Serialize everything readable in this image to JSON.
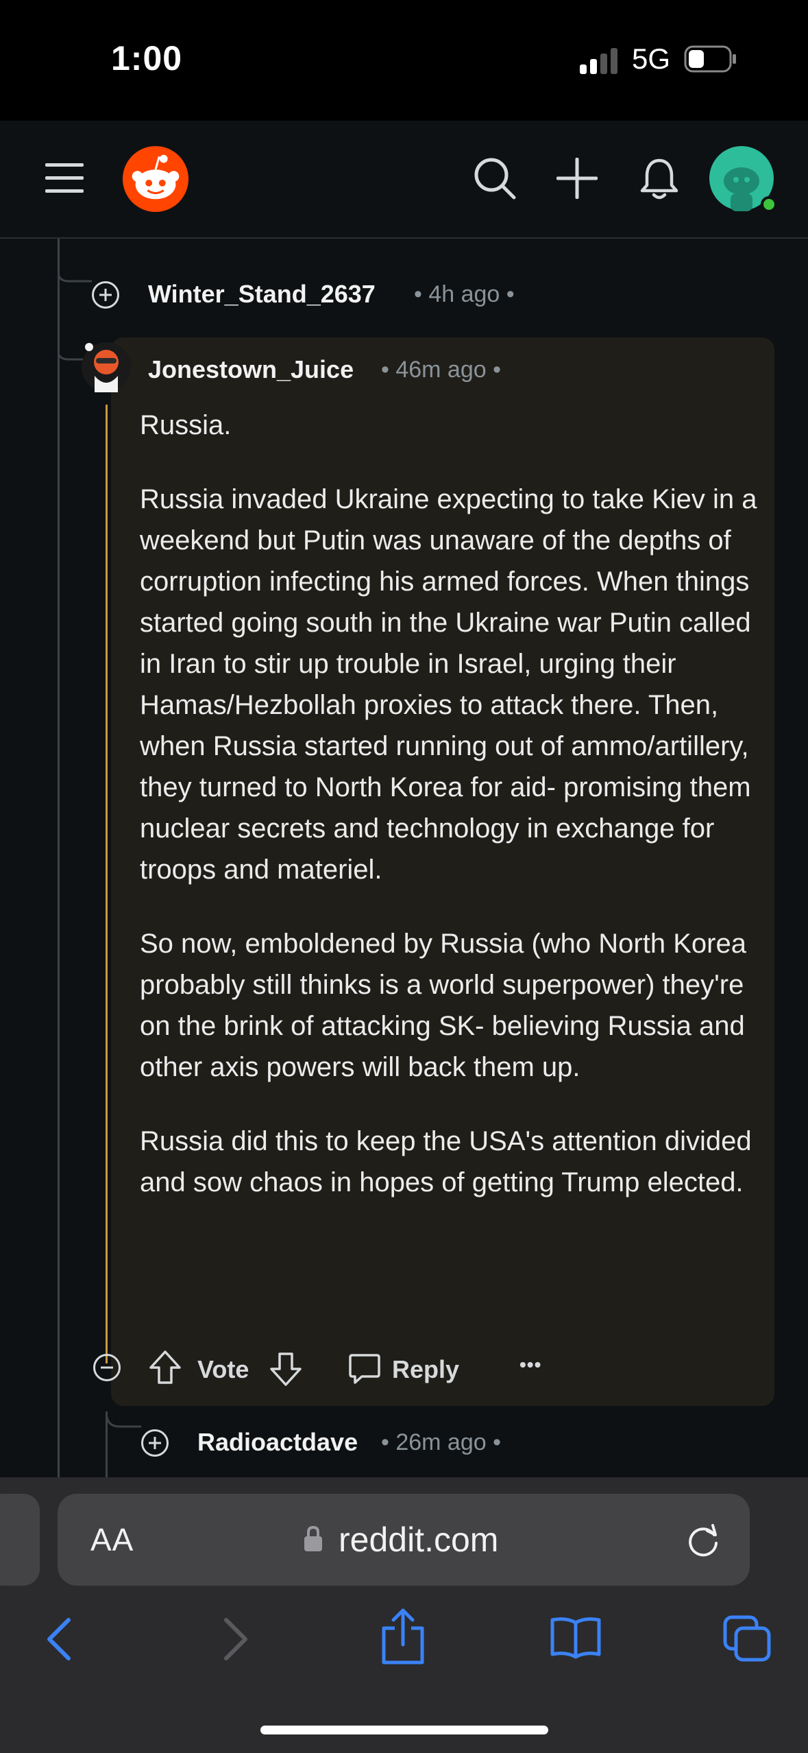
{
  "status_bar": {
    "time": "1:00",
    "network": "5G"
  },
  "header": {
    "app": "reddit"
  },
  "comments": {
    "parent": {
      "username": "Winter_Stand_2637",
      "meta": "• 4h ago •"
    },
    "highlighted": {
      "username": "Jonestown_Juice",
      "meta": "• 46m ago •",
      "paragraphs": [
        "Russia.",
        "Russia invaded Ukraine expecting to take Kiev in a weekend but Putin was unaware of the depths of corruption infecting his armed forces. When things started going south in the Ukraine war Putin called in Iran to stir up trouble in Israel, urging their Hamas/Hezbollah proxies to attack there. Then, when Russia started running out of ammo/artillery, they turned to North Korea for aid- promising them nuclear secrets and technology in exchange for troops and materiel.",
        "So now, emboldened by Russia (who North Korea probably still thinks is a world superpower) they're on the brink of attacking SK- believing Russia and other axis powers will back them up.",
        "Russia did this to keep the USA's attention divided and sow chaos in hopes of getting Trump elected."
      ],
      "actions": {
        "vote": "Vote",
        "reply": "Reply",
        "more": "•••"
      }
    },
    "child": {
      "username": "Radioactdave",
      "meta": "• 26m ago •"
    }
  },
  "browser": {
    "text_size_label": "AA",
    "url": "reddit.com"
  },
  "colors": {
    "accent": "#ff4500",
    "thread_highlight": "#c79a3a",
    "browser_icons": "#3b82f6"
  }
}
